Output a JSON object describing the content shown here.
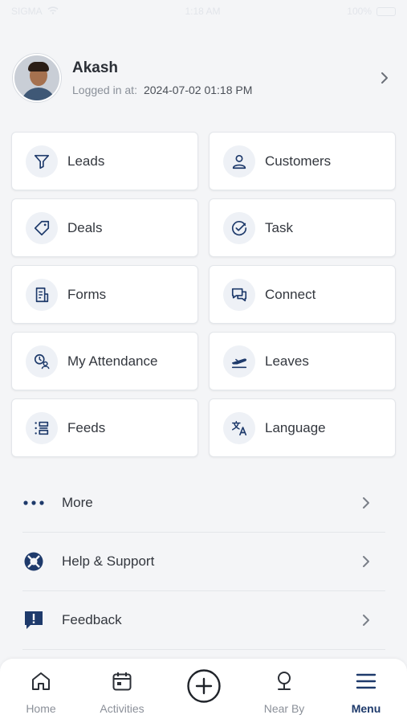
{
  "status_bar": {
    "carrier": "SIGMA",
    "time": "1:18 AM",
    "battery": "100%"
  },
  "profile": {
    "name": "Akash",
    "login_label": "Logged in at:",
    "login_value": "2024-07-02 01:18 PM"
  },
  "tiles": [
    {
      "label": "Leads",
      "icon": "filter-icon"
    },
    {
      "label": "Customers",
      "icon": "user-icon"
    },
    {
      "label": "Deals",
      "icon": "tag-icon"
    },
    {
      "label": "Task",
      "icon": "check-circle-icon"
    },
    {
      "label": "Forms",
      "icon": "document-icon"
    },
    {
      "label": "Connect",
      "icon": "chat-icon"
    },
    {
      "label": "My Attendance",
      "icon": "attendance-icon"
    },
    {
      "label": "Leaves",
      "icon": "airplane-departure-icon"
    },
    {
      "label": "Feeds",
      "icon": "feed-list-icon"
    },
    {
      "label": "Language",
      "icon": "translate-icon"
    }
  ],
  "list": [
    {
      "label": "More",
      "icon": "dots-icon"
    },
    {
      "label": "Help & Support",
      "icon": "lifebuoy-icon"
    },
    {
      "label": "Feedback",
      "icon": "feedback-icon"
    }
  ],
  "tabs": [
    {
      "label": "Home",
      "icon": "home-icon"
    },
    {
      "label": "Activities",
      "icon": "calendar-icon"
    },
    {
      "label": "Near By",
      "icon": "pin-icon"
    },
    {
      "label": "Menu",
      "icon": "menu-icon",
      "active": true
    }
  ],
  "colors": {
    "accent": "#1e3a6b",
    "background": "#f4f5f7",
    "tile_icon_bg": "#eef1f6"
  }
}
